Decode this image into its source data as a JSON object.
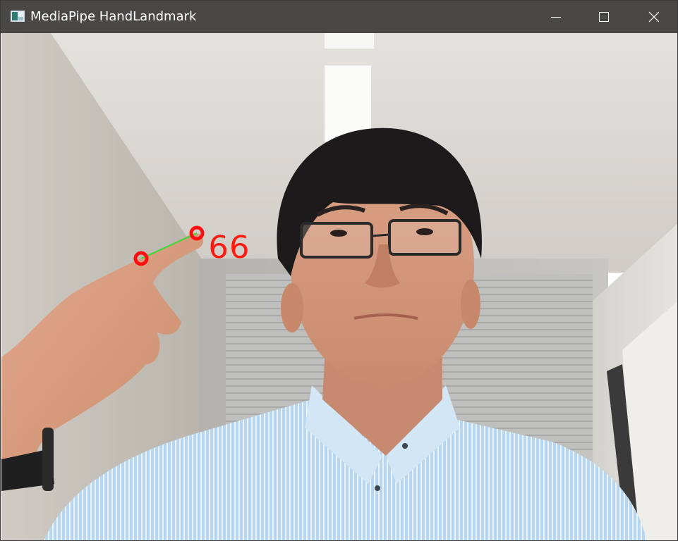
{
  "window": {
    "title": "MediaPipe HandLandmark",
    "controls": {
      "minimize": "minimize-icon",
      "maximize": "maximize-icon",
      "close": "close-icon"
    }
  },
  "overlay": {
    "distance_label": "66",
    "landmark_color": "#ff1010",
    "connector_color": "#33dd33"
  }
}
